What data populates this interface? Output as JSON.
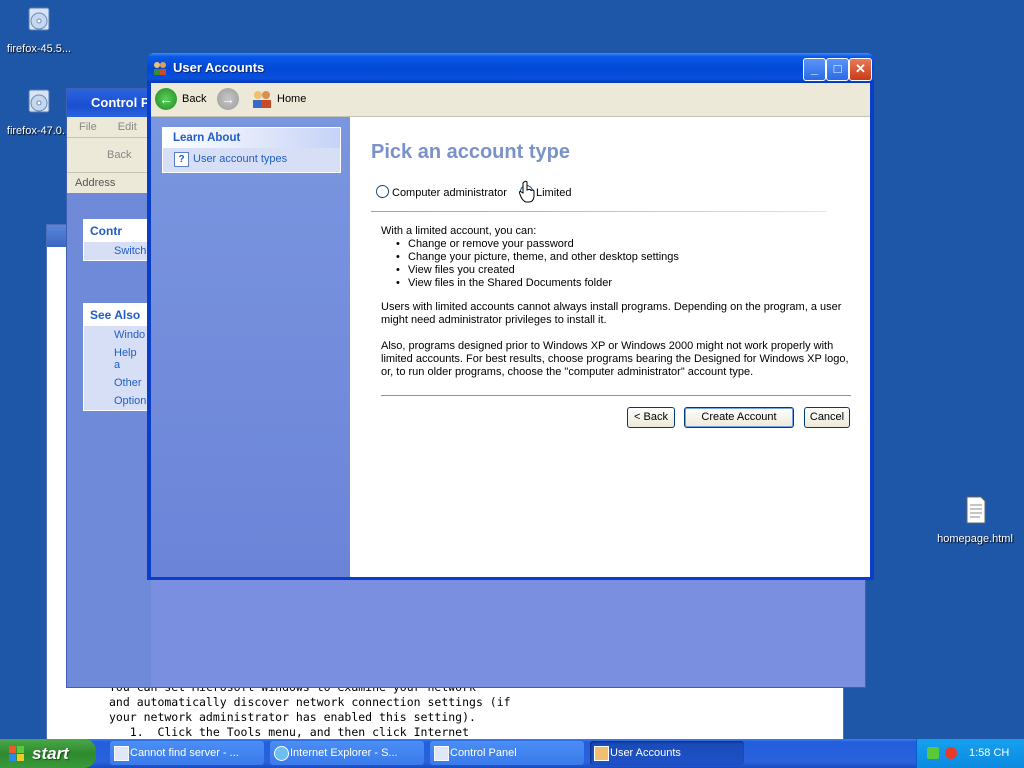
{
  "desktop": {
    "icons": [
      {
        "label": "firefox-45.5..."
      },
      {
        "label": "firefox-47.0..."
      },
      {
        "label": "homepage.html"
      }
    ]
  },
  "background_windows": {
    "control_panel": {
      "title": "Control P",
      "menu": [
        "File",
        "Edit"
      ],
      "back_label": "Back",
      "address_label": "Address",
      "panel_title": "Contr",
      "panel_item": "Switch",
      "see_also_title": "See Also",
      "see_also_items": [
        "Windo",
        "Help a",
        "Other",
        "Option"
      ]
    },
    "help_text_lines": [
      "You can set Microsoft Windows to examine your network",
      "and automatically discover network connection settings (if",
      "your network administrator has enabled this setting).",
      "   1.  Click the Tools menu, and then click Internet"
    ]
  },
  "window": {
    "title": "User Accounts",
    "toolbar": {
      "back_label": "Back",
      "home_label": "Home"
    },
    "sidebar": {
      "learn_about_title": "Learn About",
      "learn_about_item": "User account types"
    },
    "main": {
      "heading": "Pick an account type",
      "option_admin": "Computer administrator",
      "option_limited": "Limited",
      "intro": "With a limited account, you can:",
      "bullets": [
        "Change or remove your password",
        "Change your picture, theme, and other desktop settings",
        "View files you created",
        "View files in the Shared Documents folder"
      ],
      "para1": "Users with limited accounts cannot always install programs. Depending on the program, a user might need administrator privileges to install it.",
      "para2": "Also, programs designed prior to Windows XP or Windows 2000 might not work properly with limited accounts. For best results, choose programs bearing the Designed for Windows XP logo, or, to run older programs, choose the \"computer administrator\" account type.",
      "buttons": {
        "back": "< Back",
        "create": "Create Account",
        "cancel": "Cancel"
      }
    }
  },
  "taskbar": {
    "start_label": "start",
    "tasks": [
      {
        "label": "Cannot find server - ..."
      },
      {
        "label": "Internet Explorer - S..."
      },
      {
        "label": "Control Panel"
      },
      {
        "label": "User Accounts"
      }
    ],
    "clock": "1:58 CH"
  }
}
